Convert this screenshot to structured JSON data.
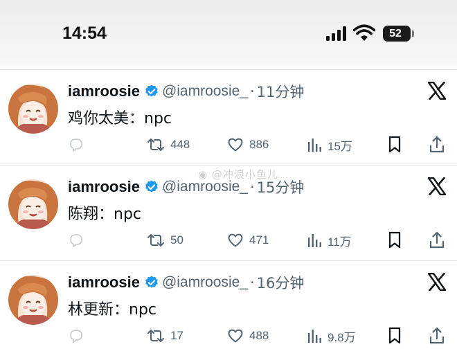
{
  "status_bar": {
    "time": "14:54",
    "battery": "52",
    "icons": [
      "signal-icon",
      "wifi-icon",
      "battery-icon"
    ]
  },
  "colors": {
    "verified": "#1d9bf0",
    "secondary_text": "#536471",
    "primary_text": "#0f1419",
    "divider": "#e3e6e8"
  },
  "watermark": "@冲浪小鱼儿",
  "tweets": [
    {
      "name": "iamroosie",
      "handle": "@iamroosie_",
      "separator": "·",
      "time_ago": "11分钟",
      "text": "鸡你太美：npc",
      "retweets": "448",
      "likes": "886",
      "views": "15万"
    },
    {
      "name": "iamroosie",
      "handle": "@iamroosie_",
      "separator": "·",
      "time_ago": "15分钟",
      "text": "陈翔：npc",
      "retweets": "50",
      "likes": "471",
      "views": "11万"
    },
    {
      "name": "iamroosie",
      "handle": "@iamroosie_",
      "separator": "·",
      "time_ago": "16分钟",
      "text": "林更新：npc",
      "retweets": "17",
      "likes": "488",
      "views": "9.8万"
    }
  ]
}
